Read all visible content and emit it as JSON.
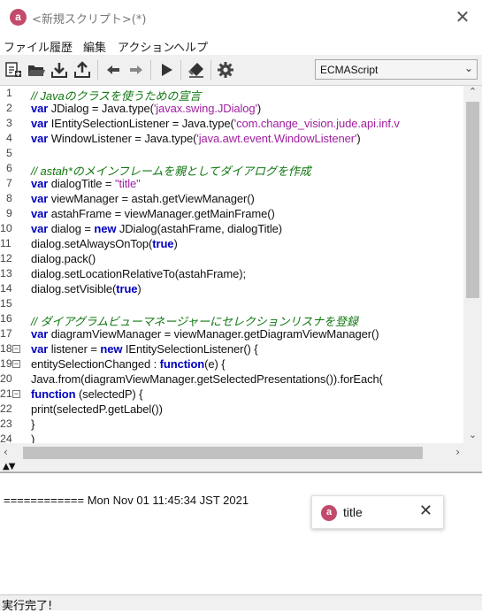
{
  "window": {
    "title": "<新規スクリプト>(*)",
    "logo_letter": "a"
  },
  "menu": [
    "ファイル",
    "履歴",
    "編集",
    "アクション",
    "ヘルプ"
  ],
  "toolbar": {
    "icons": [
      "new-script-icon",
      "open-folder-icon",
      "download-icon",
      "upload-icon",
      "undo-icon",
      "redo-icon",
      "run-icon",
      "eraser-icon",
      "gear-icon"
    ],
    "language": "ECMAScript"
  },
  "editor": {
    "lines": [
      {
        "n": "1",
        "fold": "",
        "tokens": [
          [
            "cm",
            "// Javaのクラスを使うための宣言"
          ]
        ]
      },
      {
        "n": "2",
        "fold": "",
        "tokens": [
          [
            "kw",
            "var"
          ],
          [
            "",
            " JDialog = Java.type("
          ],
          [
            "st",
            "'javax.swing.JDialog'"
          ],
          [
            "",
            ")"
          ]
        ]
      },
      {
        "n": "3",
        "fold": "",
        "tokens": [
          [
            "kw",
            "var"
          ],
          [
            "",
            " IEntitySelectionListener = Java.type("
          ],
          [
            "st",
            "'com.change_vision.jude.api.inf.v"
          ]
        ]
      },
      {
        "n": "4",
        "fold": "",
        "tokens": [
          [
            "kw",
            "var"
          ],
          [
            "",
            " WindowListener = Java.type("
          ],
          [
            "st",
            "'java.awt.event.WindowListener'"
          ],
          [
            "",
            ")"
          ]
        ]
      },
      {
        "n": "5",
        "fold": "",
        "tokens": [
          [
            "",
            ""
          ]
        ]
      },
      {
        "n": "6",
        "fold": "",
        "tokens": [
          [
            "cm",
            "// astah*のメインフレームを親としてダイアログを作成"
          ]
        ]
      },
      {
        "n": "7",
        "fold": "",
        "tokens": [
          [
            "kw",
            "var"
          ],
          [
            "",
            " dialogTitle = "
          ],
          [
            "st",
            "\"title\""
          ]
        ]
      },
      {
        "n": "8",
        "fold": "",
        "tokens": [
          [
            "kw",
            "var"
          ],
          [
            "",
            " viewManager = astah.getViewManager()"
          ]
        ]
      },
      {
        "n": "9",
        "fold": "",
        "tokens": [
          [
            "kw",
            "var"
          ],
          [
            "",
            " astahFrame = viewManager.getMainFrame()"
          ]
        ]
      },
      {
        "n": "10",
        "fold": "",
        "tokens": [
          [
            "kw",
            "var"
          ],
          [
            "",
            " dialog = "
          ],
          [
            "kw",
            "new"
          ],
          [
            "",
            " JDialog(astahFrame, dialogTitle)"
          ]
        ]
      },
      {
        "n": "11",
        "fold": "",
        "tokens": [
          [
            "",
            "dialog.setAlwaysOnTop("
          ],
          [
            "kw",
            "true"
          ],
          [
            "",
            ")"
          ]
        ]
      },
      {
        "n": "12",
        "fold": "",
        "tokens": [
          [
            "",
            "dialog.pack()"
          ]
        ]
      },
      {
        "n": "13",
        "fold": "",
        "tokens": [
          [
            "",
            "dialog.setLocationRelativeTo(astahFrame);"
          ]
        ]
      },
      {
        "n": "14",
        "fold": "",
        "tokens": [
          [
            "",
            "dialog.setVisible("
          ],
          [
            "kw",
            "true"
          ],
          [
            "",
            ")"
          ]
        ]
      },
      {
        "n": "15",
        "fold": "",
        "tokens": [
          [
            "",
            ""
          ]
        ]
      },
      {
        "n": "16",
        "fold": "",
        "tokens": [
          [
            "cm",
            "// ダイアグラムビューマネージャーにセレクションリスナを登録"
          ]
        ]
      },
      {
        "n": "17",
        "fold": "",
        "tokens": [
          [
            "kw",
            "var"
          ],
          [
            "",
            " diagramViewManager = viewManager.getDiagramViewManager()"
          ]
        ]
      },
      {
        "n": "18",
        "fold": "⊟",
        "tokens": [
          [
            "kw",
            "var"
          ],
          [
            "",
            " listener = "
          ],
          [
            "kw",
            "new"
          ],
          [
            "",
            " IEntitySelectionListener() {"
          ]
        ]
      },
      {
        "n": "19",
        "fold": "⊟",
        "tokens": [
          [
            "",
            "entitySelectionChanged : "
          ],
          [
            "kw",
            "function"
          ],
          [
            "",
            "(e) {"
          ]
        ]
      },
      {
        "n": "20",
        "fold": "",
        "tokens": [
          [
            "",
            "Java.from(diagramViewManager.getSelectedPresentations()).forEach("
          ]
        ]
      },
      {
        "n": "21",
        "fold": "⊟",
        "tokens": [
          [
            "kw",
            "function"
          ],
          [
            "",
            " (selectedP) {"
          ]
        ]
      },
      {
        "n": "22",
        "fold": "",
        "tokens": [
          [
            "",
            "print(selectedP.getLabel())"
          ]
        ]
      },
      {
        "n": "23",
        "fold": "",
        "tokens": [
          [
            "",
            "}"
          ]
        ]
      },
      {
        "n": "24",
        "fold": "",
        "tokens": [
          [
            "",
            ")"
          ]
        ]
      }
    ]
  },
  "console": {
    "text": "============ Mon Nov 01 11:45:34 JST 2021"
  },
  "popup": {
    "title": "title",
    "logo_letter": "a"
  },
  "status": "実行完了!",
  "colors": {
    "keyword": "#0000c0",
    "string": "#a020a0",
    "comment": "#117711",
    "logo": "#c24b6c"
  }
}
